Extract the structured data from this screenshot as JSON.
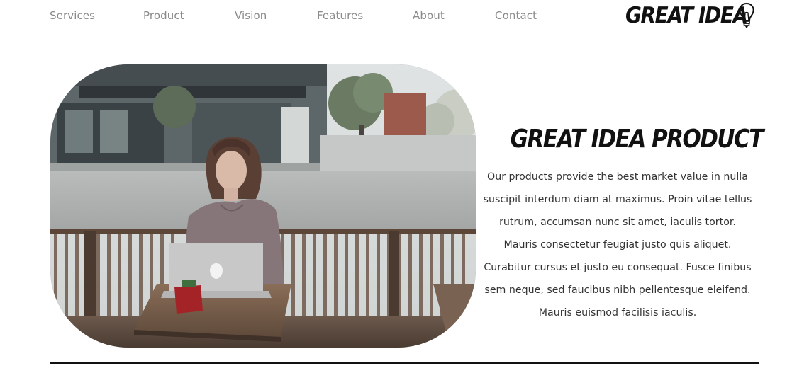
{
  "nav": {
    "items": [
      {
        "label": "Services"
      },
      {
        "label": "Product"
      },
      {
        "label": "Vision"
      },
      {
        "label": "Features"
      },
      {
        "label": "About"
      },
      {
        "label": "Contact"
      }
    ]
  },
  "logo": {
    "text": "GREAT IDEA",
    "icon": "lightbulb-icon"
  },
  "hero": {
    "image_alt": "Woman working on a laptop at an outdoor cafe table",
    "title": "GREAT IDEA PRODUCT",
    "description": "Our products provide the best market value in nulla suscipit interdum diam at maximus. Proin vitae tellus rutrum, accumsan nunc sit amet, iaculis tortor. Mauris consectetur feugiat justo quis aliquet. Curabitur cursus et justo eu consequat. Fusce finibus sem neque, sed faucibus nibh pellentesque eleifend. Mauris euismod facilisis iaculis."
  },
  "colors": {
    "nav_text": "#8a8a8a",
    "heading": "#111111",
    "body_text": "#333333",
    "background": "#ffffff"
  }
}
